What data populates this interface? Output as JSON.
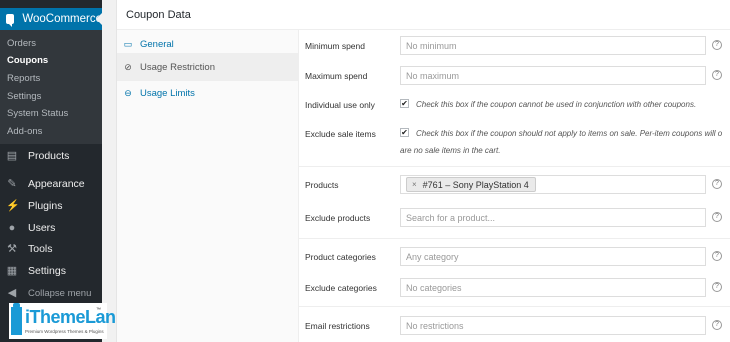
{
  "sidebar": {
    "woocommerce_label": "WooCommerce",
    "submenu": [
      "Orders",
      "Coupons",
      "Reports",
      "Settings",
      "System Status",
      "Add-ons"
    ],
    "current": "Coupons",
    "menu": [
      {
        "label": "Products",
        "icon": "products-icon"
      },
      {
        "label": "Appearance",
        "icon": "appearance-icon"
      },
      {
        "label": "Plugins",
        "icon": "plugins-icon"
      },
      {
        "label": "Users",
        "icon": "users-icon"
      },
      {
        "label": "Tools",
        "icon": "tools-icon"
      },
      {
        "label": "Settings",
        "icon": "settings-icon"
      }
    ],
    "collapse_label": "Collapse menu"
  },
  "logo": {
    "brand": "iThemeLand",
    "tm": "™",
    "tagline": "Premium Wordpress Themes & Plugins"
  },
  "panel": {
    "title": "Coupon Data",
    "tabs": [
      {
        "label": "General",
        "icon": "ticket-icon"
      },
      {
        "label": "Usage Restriction",
        "icon": "restriction-icon"
      },
      {
        "label": "Usage Limits",
        "icon": "limits-icon"
      }
    ],
    "active_tab": "Usage Restriction",
    "fields": {
      "minimum_spend": {
        "label": "Minimum spend",
        "placeholder": "No minimum"
      },
      "maximum_spend": {
        "label": "Maximum spend",
        "placeholder": "No maximum"
      },
      "individual_use": {
        "label": "Individual use only",
        "checked": true,
        "description": "Check this box if the coupon cannot be used in conjunction with other coupons."
      },
      "exclude_sale": {
        "label": "Exclude sale items",
        "checked": true,
        "description_line1": "Check this box if the coupon should not apply to items on sale. Per-item coupons will o",
        "description_line2": "are no sale items in the cart."
      },
      "products": {
        "label": "Products",
        "token": "#761 – Sony PlayStation 4",
        "token_remove": "×"
      },
      "exclude_products": {
        "label": "Exclude products",
        "placeholder": "Search for a product..."
      },
      "product_categories": {
        "label": "Product categories",
        "placeholder": "Any category"
      },
      "exclude_categories": {
        "label": "Exclude categories",
        "placeholder": "No categories"
      },
      "email_restrictions": {
        "label": "Email restrictions",
        "placeholder": "No restrictions"
      }
    },
    "help_glyph": "?"
  },
  "colors": {
    "sidebar_bg": "#23282d",
    "submenu_bg": "#32373c",
    "accent": "#0073aa",
    "link": "#0073aa"
  }
}
